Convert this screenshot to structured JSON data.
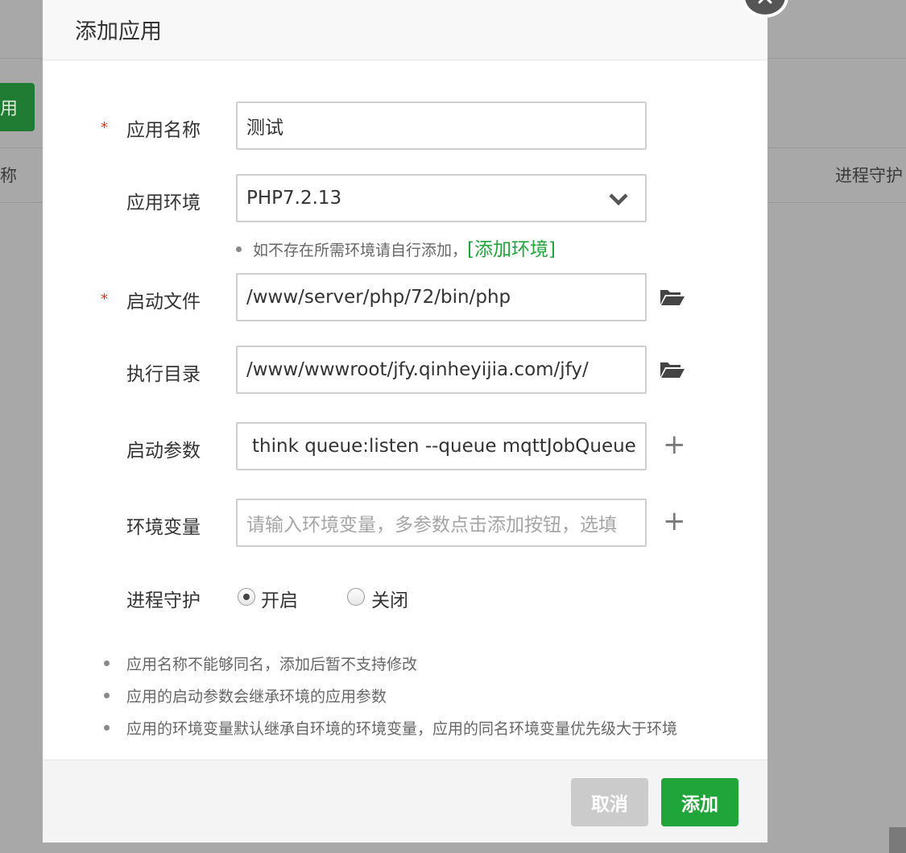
{
  "background": {
    "button_label": "用",
    "col_left": "称",
    "col_right": "进程守护"
  },
  "dialog": {
    "title": "添加应用",
    "close_icon": "close-icon",
    "fields": {
      "app_name": {
        "label": "应用名称",
        "value": "测试",
        "required": true
      },
      "app_env": {
        "label": "应用环境",
        "value": "PHP7.2.13"
      },
      "env_hint": {
        "text": "如不存在所需环境请自行添加，",
        "link": "[添加环境]"
      },
      "start_file": {
        "label": "启动文件",
        "value": "/www/server/php/72/bin/php",
        "required": true
      },
      "exec_dir": {
        "label": "执行目录",
        "value": "/www/wwwroot/jfy.qinheyijia.com/jfy/"
      },
      "start_args": {
        "label": "启动参数",
        "value": "think queue:listen --queue mqttJobQueue"
      },
      "env_vars": {
        "label": "环境变量",
        "placeholder": "请输入环境变量，多参数点击添加按钮，选填"
      },
      "daemon": {
        "label": "进程守护",
        "on_label": "开启",
        "off_label": "关闭",
        "selected": "on"
      }
    },
    "notes": [
      "应用名称不能够同名，添加后暂不支持修改",
      "应用的启动参数会继承环境的应用参数",
      "应用的环境变量默认继承自环境的环境变量，应用的同名环境变量优先级大于环境"
    ],
    "footer": {
      "cancel_label": "取消",
      "add_label": "添加"
    },
    "colors": {
      "accent": "#20a53a",
      "required": "#e1311d"
    }
  }
}
